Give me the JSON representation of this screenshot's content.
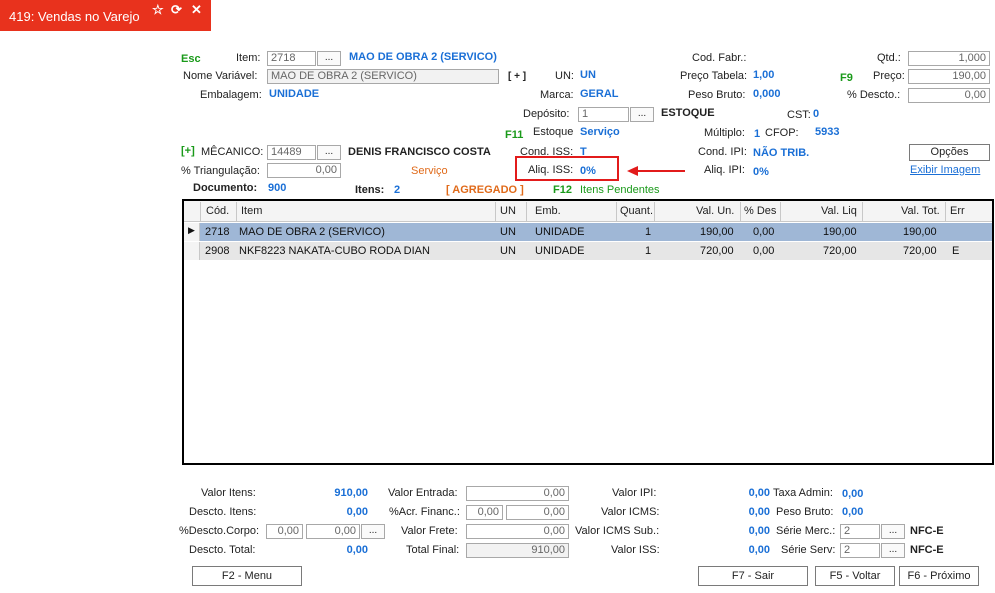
{
  "window": {
    "title": "419: Vendas no Varejo",
    "accent": "#e8321d"
  },
  "top": {
    "esc": "Esc",
    "item_label": "Item:",
    "item_value": "2718",
    "item_desc": "MAO DE OBRA 2 (SERVICO)",
    "nome_label": "Nome Variável:",
    "nome_value": "MAO DE OBRA 2 (SERVICO)",
    "nome_plus": "[ + ]",
    "un_label": "UN:",
    "un_value": "UN",
    "embalagem_label": "Embalagem:",
    "embalagem_value": "UNIDADE",
    "marca_label": "Marca:",
    "marca_value": "GERAL",
    "deposito_label": "Depósito:",
    "deposito_value": "1",
    "deposito_desc": "ESTOQUE",
    "f11": "F11",
    "estoque_label": "Estoque",
    "estoque_value": "Serviço",
    "mecanico_plus": "[+]",
    "mecanico_label": "MÊCANICO:",
    "mecanico_value": "14489",
    "mecanico_name": "DENIS FRANCISCO COSTA",
    "cond_iss_label": "Cond. ISS:",
    "cond_iss_value": "T",
    "triang_label": "% Triangulação:",
    "triang_value": "0,00",
    "servico_text": "Serviço",
    "aliq_iss_label": "Aliq. ISS:",
    "aliq_iss_value": "0%",
    "documento_label": "Documento:",
    "documento_value": "900",
    "itens_label": "Itens:",
    "itens_value": "2",
    "agregado": "[ AGREGADO ]",
    "f12": "F12",
    "pendentes": "Itens Pendentes",
    "cod_fabr_label": "Cod. Fabr.:",
    "preco_tabela_label": "Preço Tabela:",
    "preco_tabela_value": "1,00",
    "peso_bruto_label": "Peso Bruto:",
    "peso_bruto_value": "0,000",
    "cst_label": "CST:",
    "cst_value": "0",
    "multiplo_label": "Múltiplo:",
    "multiplo_value": "1",
    "cfop_label": "CFOP:",
    "cfop_value": "5933",
    "cond_ipi_label": "Cond. IPI:",
    "cond_ipi_value": "NÃO TRIB.",
    "aliq_ipi_label": "Aliq. IPI:",
    "aliq_ipi_value": "0%",
    "qtd_label": "Qtd.:",
    "qtd_value": "1,000",
    "f9": "F9",
    "preco_label": "Preço:",
    "preco_value": "190,00",
    "descto_label": "% Descto.:",
    "descto_value": "0,00",
    "opcoes": "Opções",
    "exibir_imagem": "Exibir Imagem"
  },
  "grid": {
    "columns": [
      "Cód.",
      "Item",
      "UN",
      "Emb.",
      "Quant.",
      "Val. Un.",
      "% Des",
      "Val. Liq",
      "Val. Tot.",
      "Err"
    ],
    "rows": [
      {
        "cod": "2718",
        "item": "MAO DE OBRA 2 (SERVICO)",
        "un": "UN",
        "emb": "UNIDADE",
        "quant": "1",
        "val_un": "190,00",
        "des": "0,00",
        "val_liq": "190,00",
        "val_tot": "190,00",
        "err": ""
      },
      {
        "cod": "2908",
        "item": "NKF8223 NAKATA-CUBO RODA DIAN",
        "un": "UN",
        "emb": "UNIDADE",
        "quant": "1",
        "val_un": "720,00",
        "des": "0,00",
        "val_liq": "720,00",
        "val_tot": "720,00",
        "err": "E"
      }
    ],
    "selected_color": "#9fb7d6"
  },
  "totals": {
    "valor_itens_label": "Valor Itens:",
    "valor_itens": "910,00",
    "descto_itens_label": "Descto. Itens:",
    "descto_itens": "0,00",
    "descto_corpo_label": "%Descto.Corpo:",
    "descto_corpo_a": "0,00",
    "descto_corpo_b": "0,00",
    "descto_total_label": "Descto. Total:",
    "descto_total": "0,00",
    "valor_entrada_label": "Valor Entrada:",
    "valor_entrada": "0,00",
    "acr_financ_label": "%Acr. Financ.:",
    "acr_financ_a": "0,00",
    "acr_financ_b": "0,00",
    "valor_frete_label": "Valor Frete:",
    "valor_frete": "0,00",
    "total_final_label": "Total Final:",
    "total_final": "910,00",
    "valor_ipi_label": "Valor IPI:",
    "valor_ipi": "0,00",
    "valor_icms_label": "Valor ICMS:",
    "valor_icms": "0,00",
    "valor_icms_sub_label": "Valor ICMS Sub.:",
    "valor_icms_sub": "0,00",
    "valor_iss_label": "Valor ISS:",
    "valor_iss": "0,00",
    "taxa_admin_label": "Taxa Admin:",
    "taxa_admin": "0,00",
    "peso_bruto_label": "Peso Bruto:",
    "peso_bruto": "0,00",
    "serie_merc_label": "Série Merc.:",
    "serie_merc": "2",
    "nfce1": "NFC-E",
    "serie_serv_label": "Série Serv:",
    "serie_serv": "2",
    "nfce2": "NFC-E"
  },
  "buttons": {
    "menu": "F2 - Menu",
    "sair": "F7 - Sair",
    "voltar": "F5 - Voltar",
    "proximo": "F6 - Próximo"
  }
}
